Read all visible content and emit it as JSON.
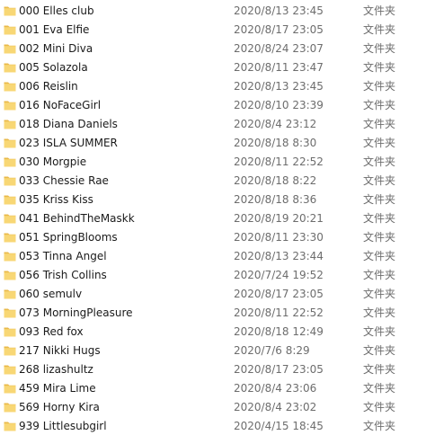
{
  "colors": {
    "folder_body": "#F8D775",
    "folder_tab": "#E9B94A",
    "name_text": "#1a1a1a",
    "meta_text": "#6d6d6d"
  },
  "icon": "folder-icon",
  "files": [
    {
      "name": "000 Elles club",
      "date": "2020/8/13 23:45",
      "type": "文件夹"
    },
    {
      "name": "001 Eva Elfie",
      "date": "2020/8/17 23:05",
      "type": "文件夹"
    },
    {
      "name": "002 Mini Diva",
      "date": "2020/8/24 23:07",
      "type": "文件夹"
    },
    {
      "name": "005 Solazola",
      "date": "2020/8/11 23:47",
      "type": "文件夹"
    },
    {
      "name": "006 Reislin",
      "date": "2020/8/13 23:45",
      "type": "文件夹"
    },
    {
      "name": "016 NoFaceGirl",
      "date": "2020/8/10 23:39",
      "type": "文件夹"
    },
    {
      "name": "018 Diana Daniels",
      "date": "2020/8/4 23:12",
      "type": "文件夹"
    },
    {
      "name": "023 ISLA SUMMER",
      "date": "2020/8/18 8:30",
      "type": "文件夹"
    },
    {
      "name": "030 Morgpie",
      "date": "2020/8/11 22:52",
      "type": "文件夹"
    },
    {
      "name": "033 Chessie Rae",
      "date": "2020/8/18 8:22",
      "type": "文件夹"
    },
    {
      "name": "035 Kriss Kiss",
      "date": "2020/8/18 8:36",
      "type": "文件夹"
    },
    {
      "name": "041 BehindTheMaskk",
      "date": "2020/8/19 20:21",
      "type": "文件夹"
    },
    {
      "name": "051 SpringBlooms",
      "date": "2020/8/11 23:30",
      "type": "文件夹"
    },
    {
      "name": "053 Tinna Angel",
      "date": "2020/8/13 23:44",
      "type": "文件夹"
    },
    {
      "name": "056 Trish Collins",
      "date": "2020/7/24 19:52",
      "type": "文件夹"
    },
    {
      "name": "060 semulv",
      "date": "2020/8/17 23:05",
      "type": "文件夹"
    },
    {
      "name": "073 MorningPleasure",
      "date": "2020/8/11 22:52",
      "type": "文件夹"
    },
    {
      "name": "093 Red fox",
      "date": "2020/8/18 12:49",
      "type": "文件夹"
    },
    {
      "name": "217 Nikki Hugs",
      "date": "2020/7/6 8:29",
      "type": "文件夹"
    },
    {
      "name": "268 lizashultz",
      "date": "2020/8/17 23:05",
      "type": "文件夹"
    },
    {
      "name": "459 Mira Lime",
      "date": "2020/8/4 23:06",
      "type": "文件夹"
    },
    {
      "name": "569 Horny Kira",
      "date": "2020/8/4 23:02",
      "type": "文件夹"
    },
    {
      "name": "939 Littlesubgirl",
      "date": "2020/4/15 18:45",
      "type": "文件夹"
    }
  ]
}
